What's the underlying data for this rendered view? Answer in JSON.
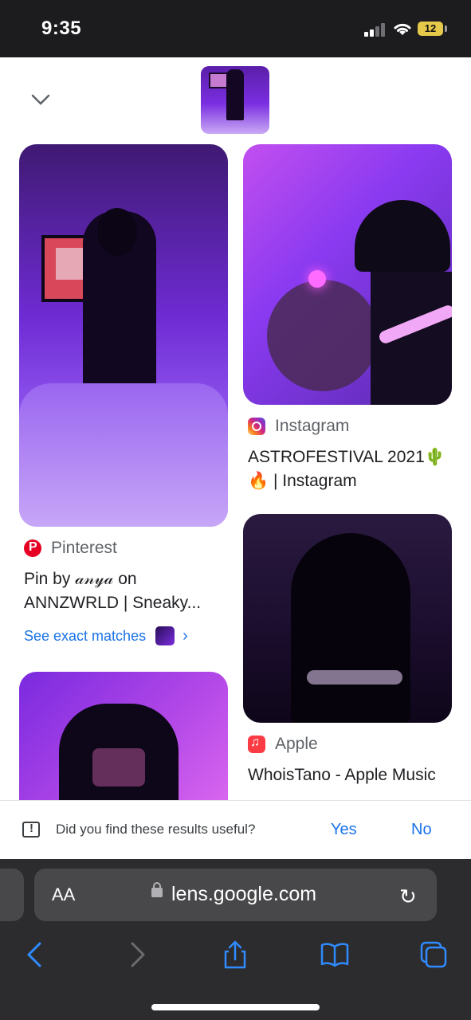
{
  "status_bar": {
    "time": "9:35",
    "battery": "12"
  },
  "results": [
    {
      "source": "Pinterest",
      "title": "Pin by 𝒶𝓃𝓎𝒶 on ANNZWRLD | Sneaky...",
      "see_exact": "See exact matches"
    },
    {
      "source": "Instagram",
      "title": "ASTROFESTIVAL 2021🌵🔥 | Instagram"
    },
    {
      "source": "Apple",
      "title": "WhoisTano - Apple Music"
    }
  ],
  "feedback": {
    "question": "Did you find these results useful?",
    "yes": "Yes",
    "no": "No"
  },
  "safari": {
    "aa": "AA",
    "url": "lens.google.com"
  },
  "colors": {
    "accent_blue": "#1a73e8",
    "safari_blue": "#2f8bff",
    "status_bg": "#1c1c1e"
  }
}
